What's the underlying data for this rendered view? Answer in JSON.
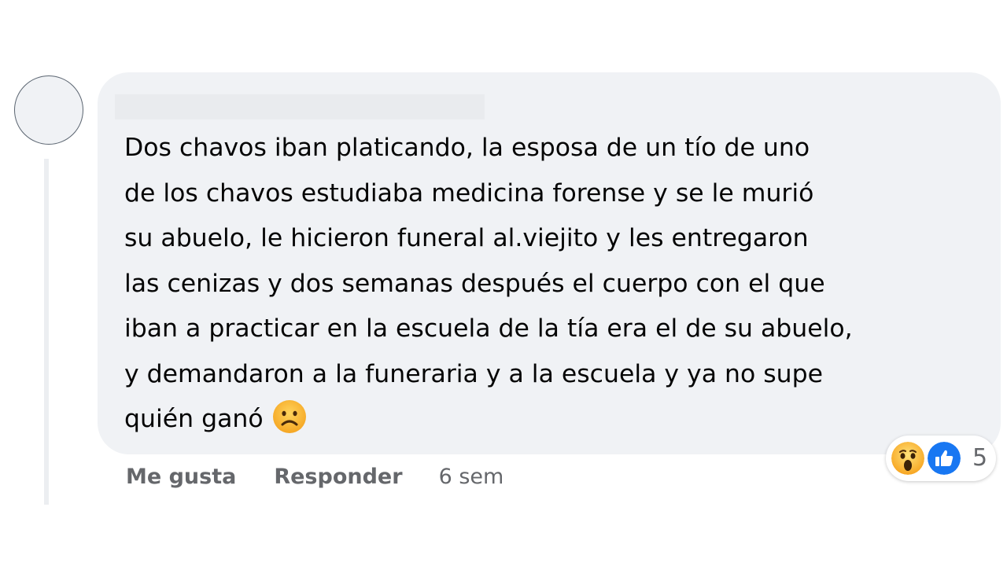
{
  "comment": {
    "author_name": "",
    "text": "Dos chavos iban platicando, la esposa de un tío de uno\nde los chavos estudiaba medicina forense y se le murió\nsu abuelo, le hicieron funeral al.viejito y les entregaron\nlas cenizas y dos semanas después el cuerpo con el que\niban a practicar en la escuela de la tía era el de su abuelo,\ny demandaron a la funeraria y a la escuela y ya no supe\nquién ganó",
    "inline_emoji": "frowning-face-icon"
  },
  "reactions": {
    "icons": [
      "wow-reaction-icon",
      "like-reaction-icon"
    ],
    "count": "5"
  },
  "actions": {
    "like_label": "Me gusta",
    "reply_label": "Responder",
    "timestamp": "6 sem"
  },
  "colors": {
    "bubble_bg": "#f0f2f5",
    "meta_text": "#65676b",
    "body_text": "#050505",
    "like_blue": "#1877f2",
    "emoji_yellow": "#f7b125"
  }
}
